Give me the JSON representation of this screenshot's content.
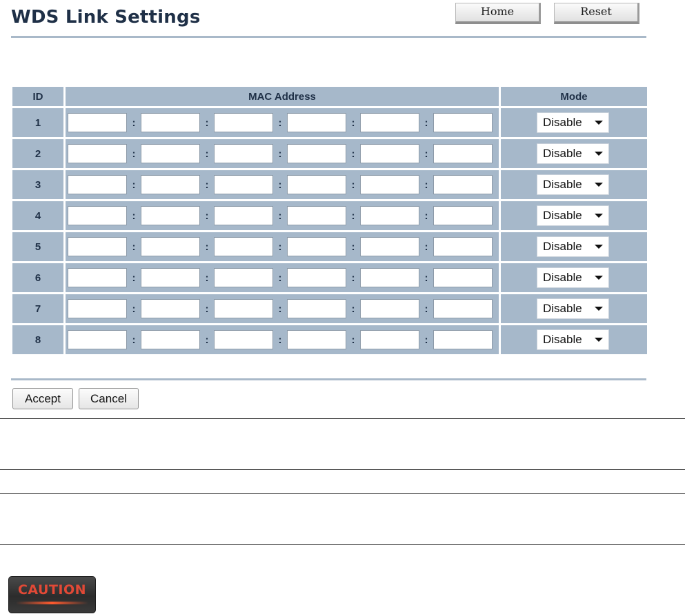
{
  "header": {
    "title": "WDS Link Settings",
    "home_label": "Home",
    "reset_label": "Reset"
  },
  "table": {
    "columns": [
      "ID",
      "MAC Address",
      "Mode"
    ],
    "mac_separator": ":",
    "rows": [
      {
        "id": "1",
        "mac": [
          "",
          "",
          "",
          "",
          "",
          ""
        ],
        "mode": "Disable"
      },
      {
        "id": "2",
        "mac": [
          "",
          "",
          "",
          "",
          "",
          ""
        ],
        "mode": "Disable"
      },
      {
        "id": "3",
        "mac": [
          "",
          "",
          "",
          "",
          "",
          ""
        ],
        "mode": "Disable"
      },
      {
        "id": "4",
        "mac": [
          "",
          "",
          "",
          "",
          "",
          ""
        ],
        "mode": "Disable"
      },
      {
        "id": "5",
        "mac": [
          "",
          "",
          "",
          "",
          "",
          ""
        ],
        "mode": "Disable"
      },
      {
        "id": "6",
        "mac": [
          "",
          "",
          "",
          "",
          "",
          ""
        ],
        "mode": "Disable"
      },
      {
        "id": "7",
        "mac": [
          "",
          "",
          "",
          "",
          "",
          ""
        ],
        "mode": "Disable"
      },
      {
        "id": "8",
        "mac": [
          "",
          "",
          "",
          "",
          "",
          ""
        ],
        "mode": "Disable"
      }
    ]
  },
  "form": {
    "accept_label": "Accept",
    "cancel_label": "Cancel"
  },
  "caution": {
    "label": "CAUTION"
  },
  "colors": {
    "header_bg": "#a6b8ca",
    "title_color": "#1f3047",
    "rule_color": "#a9b9c9"
  }
}
